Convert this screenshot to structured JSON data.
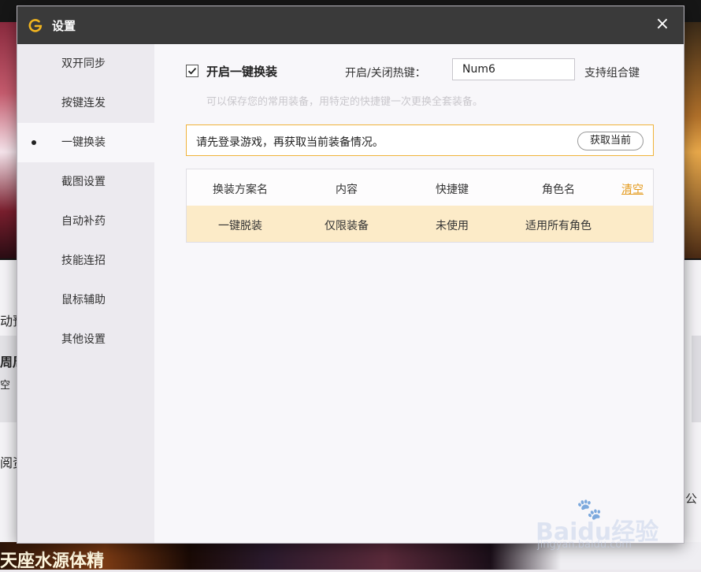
{
  "background": {
    "frag_1": "动预",
    "frag_2": "周周",
    "frag_3": "空",
    "frag_4": "阅资",
    "frag_bottom": "天座水源体精",
    "frag_right": "公"
  },
  "dialog": {
    "title": "设置",
    "close_label": "×"
  },
  "sidebar": {
    "items": [
      {
        "label": "双开同步"
      },
      {
        "label": "按键连发"
      },
      {
        "label": "一键换装"
      },
      {
        "label": "截图设置"
      },
      {
        "label": "自动补药"
      },
      {
        "label": "技能连招"
      },
      {
        "label": "鼠标辅助"
      },
      {
        "label": "其他设置"
      }
    ],
    "active_index": 2
  },
  "outfit": {
    "enable_label": "开启一键换装",
    "enable_checked": true,
    "hotkey_label": "开启/关闭热键：",
    "hotkey_value": "Num6",
    "combo_label": "支持组合键",
    "hint": "可以保存您的常用装备，用特定的快捷键一次更换全套装备。",
    "notice_text": "请先登录游戏，再获取当前装备情况。",
    "fetch_button": "获取当前"
  },
  "table": {
    "columns": [
      "换装方案名",
      "内容",
      "快捷键",
      "角色名"
    ],
    "clear_label": "清空",
    "rows": [
      [
        "一键脱装",
        "仅限装备",
        "未使用",
        "适用所有角色"
      ]
    ]
  },
  "watermark": {
    "text": "Baidu经验",
    "url": "jingyan.baidu.com"
  },
  "colors": {
    "titlebar": "#3a3a3a",
    "accent": "#f0b33a",
    "row_highlight": "#fcebc8",
    "link": "#e49a1c"
  }
}
